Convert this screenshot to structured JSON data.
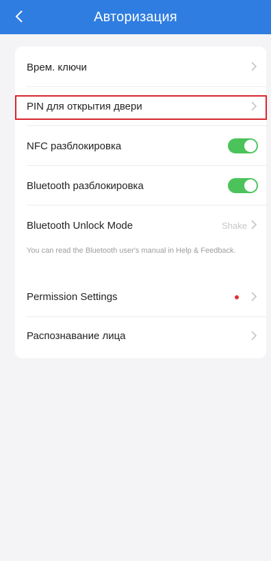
{
  "header": {
    "title": "Авторизация",
    "back_icon": "chevron-left-icon",
    "color": "#2f7de1"
  },
  "settings": {
    "temp_keys": {
      "label": "Врем. ключи"
    },
    "door_pin": {
      "label": "PIN для открытия двери",
      "highlight_color": "#d8232a"
    },
    "nfc_unlock": {
      "label": "NFC разблокировка",
      "enabled": true
    },
    "bluetooth_unlock": {
      "label": "Bluetooth разблокировка",
      "enabled": true
    },
    "bluetooth_mode": {
      "label": "Bluetooth Unlock Mode",
      "value": "Shake",
      "hint": "You can read the Bluetooth user's manual in Help & Feedback."
    },
    "permission_settings": {
      "label": "Permission Settings",
      "has_badge": true
    },
    "face_recognition": {
      "label": "Распознавание лица"
    }
  },
  "colors": {
    "toggle_on": "#4cc35a",
    "badge": "#e5312d"
  }
}
